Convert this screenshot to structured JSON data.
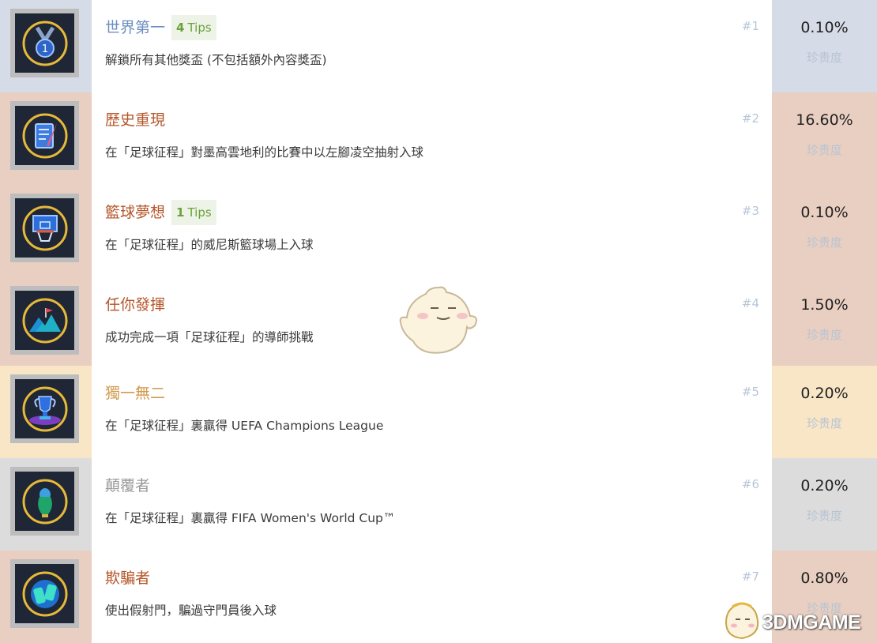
{
  "rarity_label": "珍贵度",
  "achievements": [
    {
      "title": "世界第一",
      "tips_count": "4",
      "tips_label": "Tips",
      "description": "解鎖所有其他獎盃 (不包括額外內容獎盃)",
      "rank": "#1",
      "percent": "0.10%",
      "icon": "medal-icon",
      "band_color": "#d5dbe7",
      "title_color": "#6b8fbf"
    },
    {
      "title": "歷史重現",
      "tips_count": null,
      "tips_label": null,
      "description": "在「足球征程」對墨高雲地利的比賽中以左腳凌空抽射入球",
      "rank": "#2",
      "percent": "16.60%",
      "icon": "scroll-quill-icon",
      "band_color": "#e9cfc1",
      "title_color": "#b5562a"
    },
    {
      "title": "籃球夢想",
      "tips_count": "1",
      "tips_label": "Tips",
      "description": "在「足球征程」的威尼斯籃球場上入球",
      "rank": "#3",
      "percent": "0.10%",
      "icon": "basketball-hoop-icon",
      "band_color": "#e9cfc1",
      "title_color": "#b5562a"
    },
    {
      "title": "任你發揮",
      "tips_count": null,
      "tips_label": null,
      "description": "成功完成一項「足球征程」的導師挑戰",
      "rank": "#4",
      "percent": "1.50%",
      "icon": "mountain-flag-icon",
      "band_color": "#e9cfc1",
      "title_color": "#b5562a"
    },
    {
      "title": "獨一無二",
      "tips_count": null,
      "tips_label": null,
      "description": "在「足球征程」裏贏得 UEFA Champions League",
      "rank": "#5",
      "percent": "0.20%",
      "icon": "trophy-icon",
      "band_color": "#f9e6c7",
      "title_color": "#d19a4d"
    },
    {
      "title": "顛覆者",
      "tips_count": null,
      "tips_label": null,
      "description": "在「足球征程」裏贏得 FIFA Women's World Cup™",
      "rank": "#6",
      "percent": "0.20%",
      "icon": "world-cup-icon",
      "band_color": "#dcdcdc",
      "title_color": "#9a9a9a"
    },
    {
      "title": "欺騙者",
      "tips_count": null,
      "tips_label": null,
      "description": "使出假射門，騙過守門員後入球",
      "rank": "#7",
      "percent": "0.80%",
      "icon": "feint-shot-icon",
      "band_color": "#e9cfc1",
      "title_color": "#b5562a"
    }
  ],
  "watermark": {
    "logo_text": "3DMGAME"
  }
}
